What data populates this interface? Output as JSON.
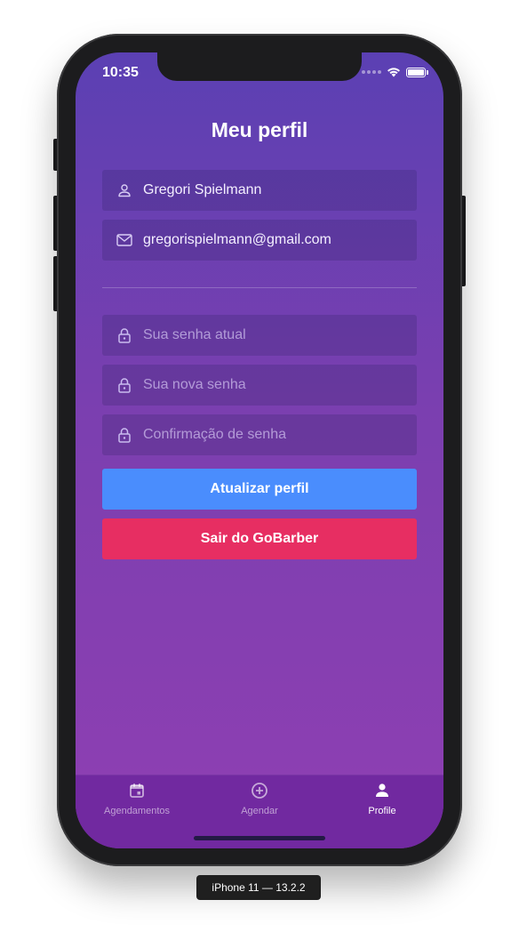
{
  "device": {
    "label": "iPhone 11 — 13.2.2"
  },
  "status_bar": {
    "time": "10:35"
  },
  "screen": {
    "title": "Meu perfil"
  },
  "form": {
    "name": {
      "value": "Gregori Spielmann",
      "icon": "user-icon"
    },
    "email": {
      "value": "gregorispielmann@gmail.com",
      "icon": "mail-icon"
    },
    "old_password": {
      "placeholder": "Sua senha atual",
      "icon": "lock-icon"
    },
    "new_password": {
      "placeholder": "Sua nova senha",
      "icon": "lock-icon"
    },
    "confirm_password": {
      "placeholder": "Confirmação de senha",
      "icon": "lock-icon"
    }
  },
  "buttons": {
    "update": "Atualizar perfil",
    "signout": "Sair do GoBarber"
  },
  "tabbar": {
    "items": [
      {
        "label": "Agendamentos",
        "icon": "calendar-icon",
        "active": false
      },
      {
        "label": "Agendar",
        "icon": "add-circle-icon",
        "active": false
      },
      {
        "label": "Profile",
        "icon": "person-icon",
        "active": true
      }
    ]
  },
  "colors": {
    "primary_button": "#4a8dfd",
    "danger_button": "#e72e62",
    "tabbar": "#7129a0",
    "gradient_top": "#5b40b3",
    "gradient_bottom": "#8f3fb2"
  }
}
